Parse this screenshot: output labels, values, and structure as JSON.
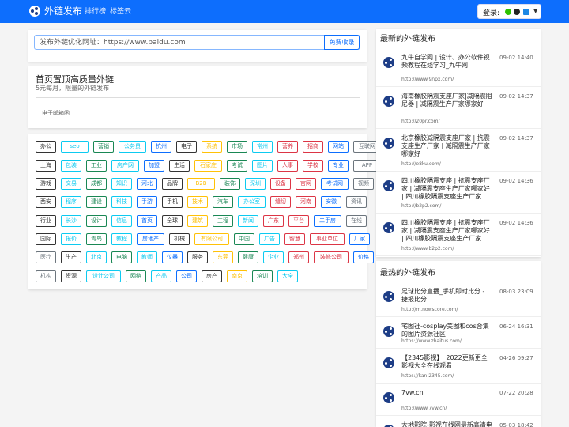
{
  "header": {
    "brand": "外链发布",
    "nav_links": [
      "排行榜",
      "标签云"
    ],
    "login_label": "登录:"
  },
  "search": {
    "placeholder": "发布外链优化网址：https://www.baidu.com",
    "button": "免费收录"
  },
  "promo": {
    "title": "首页置顶高质量外链",
    "subtitle": "5元每月，限量的外链发布",
    "email_label": "电子邮箱函"
  },
  "tags": [
    [
      "办公",
      "seo",
      "营销",
      "公务员",
      "杭州",
      "电子",
      "系统",
      "市场",
      "常州",
      "营养",
      "招商",
      "网站",
      "互联网"
    ],
    [
      "上海",
      "包装",
      "工业",
      "房产网",
      "加盟",
      "生活",
      "石家庄",
      "考试",
      "图片",
      "人事",
      "学校",
      "专业",
      "APP"
    ],
    [
      "游戏",
      "交易",
      "成都",
      "知识",
      "河北",
      "品牌",
      "B2B",
      "装饰",
      "深圳",
      "设备",
      "官网",
      "考试网",
      "视频"
    ],
    [
      "西安",
      "程序",
      "建设",
      "科技",
      "手游",
      "手机",
      "技术",
      "汽车",
      "办公室",
      "缝纫",
      "河南",
      "安徽",
      "资讯"
    ],
    [
      "行业",
      "长沙",
      "设计",
      "信息",
      "首页",
      "全球",
      "建筑",
      "工程",
      "新闻",
      "广东",
      "平台",
      "二手房",
      "在线"
    ],
    [
      "国际",
      "报价",
      "青岛",
      "教程",
      "房地产",
      "机械",
      "有限公司",
      "中国",
      "广告",
      "智慧",
      "事业单位",
      "厂家"
    ],
    [
      "医疗",
      "生产",
      "北京",
      "电脑",
      "教师",
      "仪器",
      "服务",
      "东莞",
      "健康",
      "企业",
      "郑州",
      "装修公司",
      "价格"
    ],
    [
      "机构",
      "资源",
      "设计公司",
      "网络",
      "产品",
      "公司",
      "房产",
      "南京",
      "培训",
      "大全"
    ]
  ],
  "latest": {
    "heading": "最新的外链发布",
    "items": [
      {
        "title": "九牛自学网 | 设计、办公软件视频教程在线学习_九牛网",
        "url": "http://www.9npx.com/",
        "date": "09-02 14:40"
      },
      {
        "title": "海南橡胶隔震支座厂家|减隔震阻尼器 | 减隔震生产厂家哪家好",
        "url": "http://20pr.com/",
        "date": "09-02 14:37"
      },
      {
        "title": "北京橡胶减隔震支座厂家 | 抗震支座生产厂家 | 减隔震生产厂家哪家好",
        "url": "http://e8ku.com/",
        "date": "09-02 14:37"
      },
      {
        "title": "四川橡胶隔震支座 | 抗震支座厂家 | 减隔震支座生产厂家哪家好 | 四川橡胶隔震支座生产厂家",
        "url": "http://b2p2.com/",
        "date": "09-02 14:36"
      },
      {
        "title": "四川橡胶隔震支座 | 抗震支座厂家 | 减隔震支座生产厂家哪家好 | 四川橡胶隔震支座生产厂家",
        "url": "http://www.b2p2.com/",
        "date": "09-02 14:36"
      }
    ]
  },
  "hottest": {
    "heading": "最热的外链发布",
    "items": [
      {
        "title": "足球比分直播_手机即时比分 - 捷报比分",
        "url": "http://m.nowscore.com/",
        "date": "08-03 23:09"
      },
      {
        "title": "宅图社-cosplay美图和cos合集的图片资源社区",
        "url": "https://www.zhaitus.com/",
        "date": "06-24 16:31"
      },
      {
        "title": "【2345影视】_2022更新更全影视大全在线观看",
        "url": "https://kan.2345.com/",
        "date": "04-26 09:27"
      },
      {
        "title": "7vw.cn",
        "url": "http://www.7vw.cn/",
        "date": "07-22 20:28"
      },
      {
        "title": "大地影院-影视在线网最新高清电",
        "url": "",
        "date": "05-03 18:42"
      }
    ]
  },
  "tag_colors": [
    "#333333",
    "#0dcaf0",
    "#198754",
    "#0dcaf0",
    "#0d6efd",
    "#333333",
    "#ffc107",
    "#198754",
    "#0dcaf0",
    "#dc3545",
    "#dc3545",
    "#0d6efd",
    "#6c757d"
  ]
}
